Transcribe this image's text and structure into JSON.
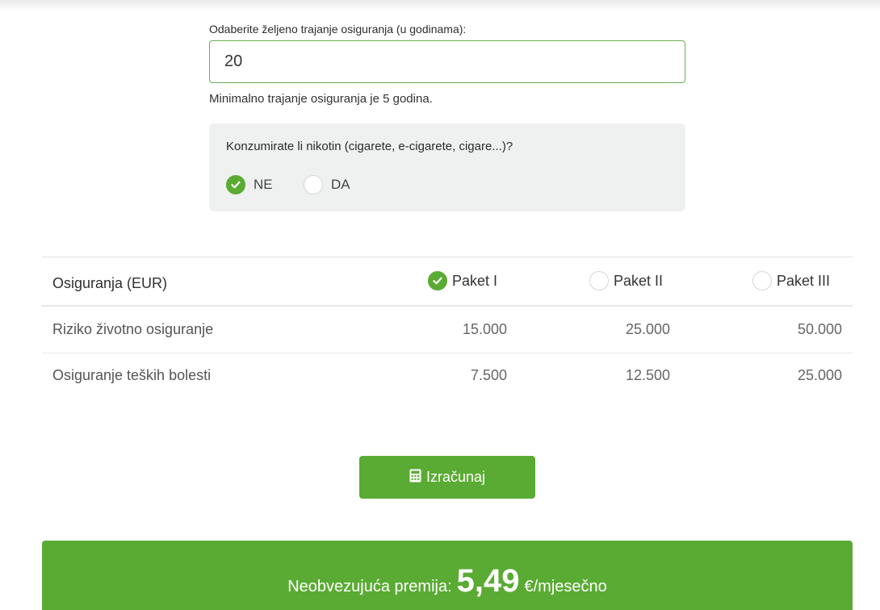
{
  "duration": {
    "label": "Odaberite željeno trajanje osiguranja (u godinama):",
    "value": "20",
    "hint": "Minimalno trajanje osiguranja je 5 godina."
  },
  "nicotine": {
    "question": "Konzumirate li nikotin (cigarete, e-cigarete, cigare...)?",
    "options": [
      {
        "label": "NE",
        "checked": true
      },
      {
        "label": "DA",
        "checked": false
      }
    ]
  },
  "table": {
    "title": "Osiguranja (EUR)",
    "packages": [
      {
        "label": "Paket I",
        "checked": true
      },
      {
        "label": "Paket II",
        "checked": false
      },
      {
        "label": "Paket III",
        "checked": false
      }
    ],
    "rows": [
      {
        "label": "Riziko životno osiguranje",
        "values": [
          "15.000",
          "25.000",
          "50.000"
        ]
      },
      {
        "label": "Osiguranje teških bolesti",
        "values": [
          "7.500",
          "12.500",
          "25.000"
        ]
      }
    ]
  },
  "calculate": {
    "label": "Izračunaj",
    "icon": "calculator-icon"
  },
  "premium": {
    "label": "Neobvezujuća premija:",
    "amount": "5,49",
    "unit": "€/mjesečno"
  },
  "colors": {
    "accent": "#5aab33",
    "panel": "#eef1ef"
  }
}
